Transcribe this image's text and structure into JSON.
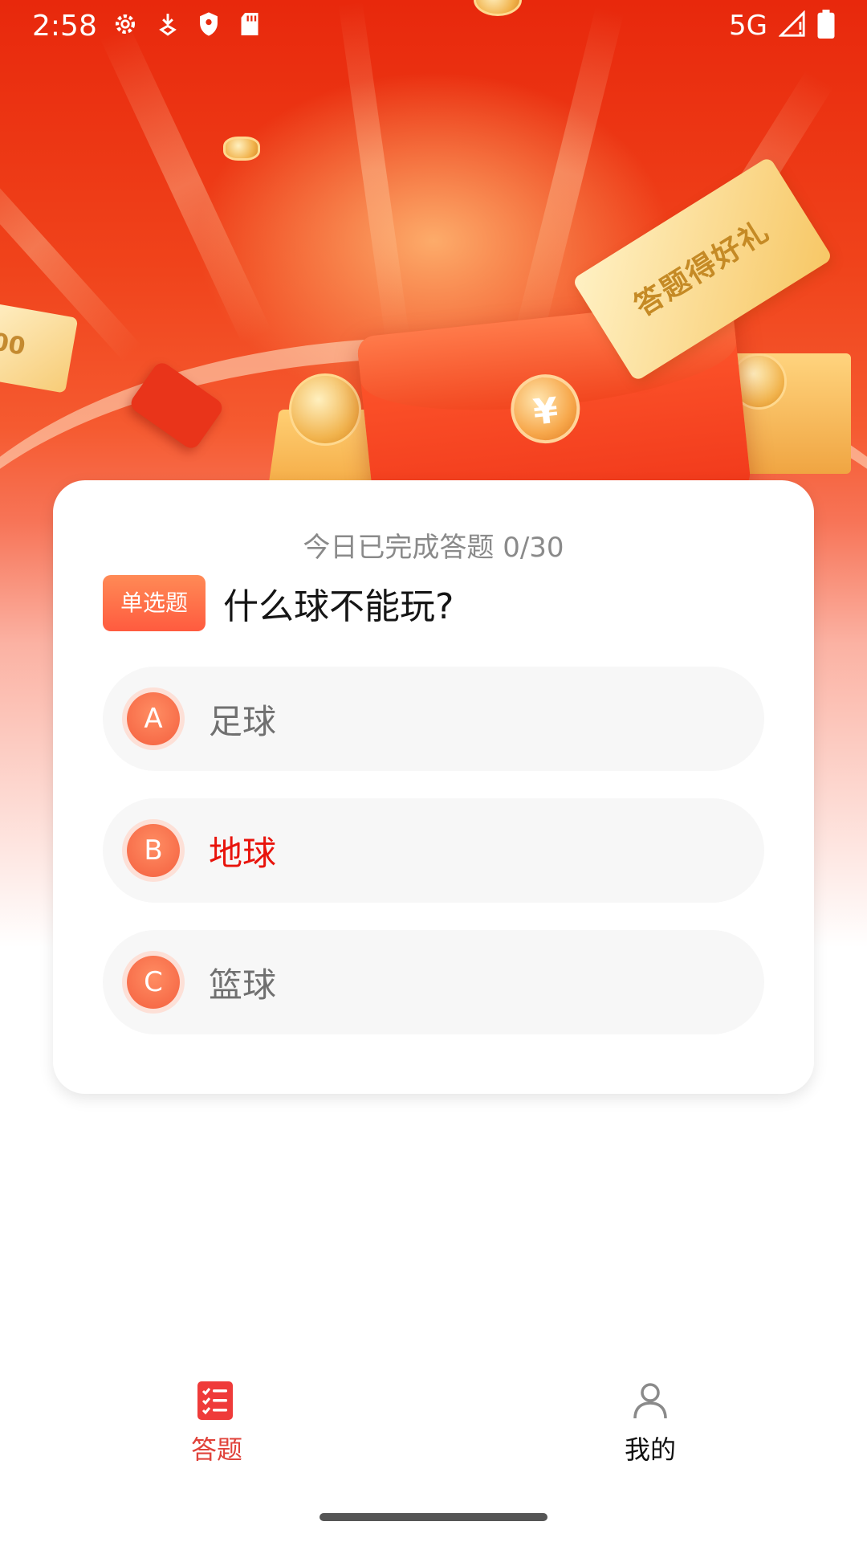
{
  "status_bar": {
    "time": "2:58",
    "network": "5G",
    "icons": [
      "settings-icon",
      "download-icon",
      "shield-icon",
      "sd-card-icon",
      "signal-icon",
      "battery-icon"
    ]
  },
  "hero": {
    "ticket_text": "答题得好礼",
    "left_ticket_text": ".00",
    "coin_symbol": "¥"
  },
  "quiz": {
    "progress_text": "今日已完成答题 0/30",
    "type_label": "单选题",
    "question": "什么球不能玩?",
    "options": [
      {
        "letter": "A",
        "text": "足球",
        "selected": false
      },
      {
        "letter": "B",
        "text": "地球",
        "selected": true
      },
      {
        "letter": "C",
        "text": "篮球",
        "selected": false
      }
    ]
  },
  "bottom_nav": {
    "items": [
      {
        "label": "答题",
        "icon": "checklist-icon",
        "active": true
      },
      {
        "label": "我的",
        "icon": "person-icon",
        "active": false
      }
    ]
  },
  "colors": {
    "accent": "#e8140c",
    "hero_top": "#e8280c",
    "badge": "#f4603f",
    "nav_active": "#e0423a"
  }
}
